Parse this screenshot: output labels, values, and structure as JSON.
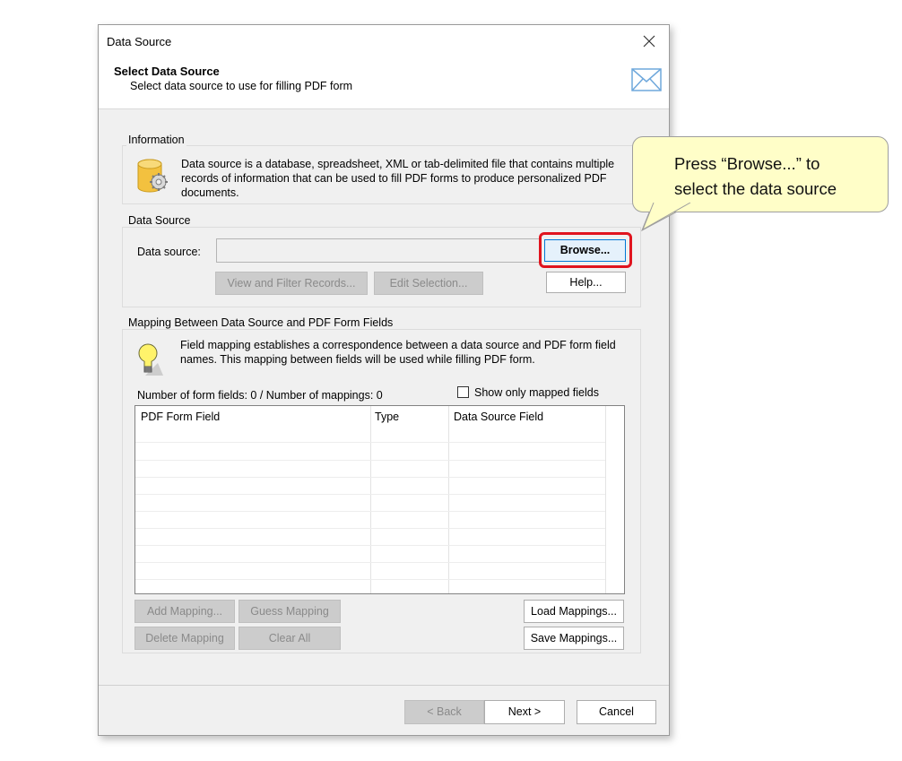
{
  "window": {
    "title": "Data Source"
  },
  "header": {
    "title": "Select Data Source",
    "subtitle": "Select data source to use for filling PDF form"
  },
  "information": {
    "label": "Information",
    "text_line1": "Data source is a database, spreadsheet, XML or tab-delimited file that contains multiple",
    "text_line2": "records of information that can be used to fill PDF forms to produce personalized PDF",
    "text_line3": "documents."
  },
  "data_source": {
    "label": "Data Source",
    "field_label": "Data source:",
    "value": "",
    "browse_label": "Browse...",
    "help_label": "Help...",
    "view_filter_label": "View and Filter Records...",
    "edit_selection_label": "Edit Selection..."
  },
  "mapping": {
    "label": "Mapping Between Data Source and PDF Form Fields",
    "text_line1": "Field mapping establishes a correspondence between a data source and PDF form field",
    "text_line2": "names. This mapping between fields will be used while filling PDF form.",
    "counts": "Number of form fields: 0 / Number of mappings: 0",
    "show_only_mapped": "Show only mapped fields",
    "columns": [
      "PDF Form Field",
      "Type",
      "Data Source Field"
    ],
    "add_mapping": "Add Mapping...",
    "guess_mapping": "Guess Mapping",
    "delete_mapping": "Delete Mapping",
    "clear_all": "Clear All",
    "load_mappings": "Load Mappings...",
    "save_mappings": "Save Mappings..."
  },
  "footer": {
    "back": "< Back",
    "next": "Next >",
    "cancel": "Cancel"
  },
  "callout": {
    "text": "Press “Browse...” to\nselect the data source"
  },
  "colors": {
    "highlight": "#e0141e",
    "callout_bg": "#fffec8",
    "dialog_bg": "#f0f0f0"
  }
}
